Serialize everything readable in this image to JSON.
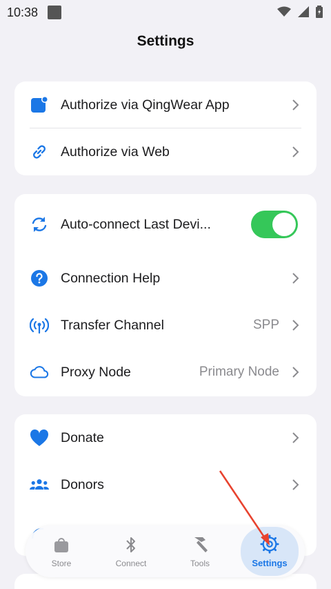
{
  "status": {
    "time": "10:38"
  },
  "header": {
    "title": "Settings"
  },
  "group1": [
    {
      "label": "Authorize via QingWear App",
      "icon": "qingwear-app-icon"
    },
    {
      "label": "Authorize via Web",
      "icon": "link-icon"
    }
  ],
  "group2": [
    {
      "label": "Auto-connect Last Devi...",
      "icon": "sync-icon",
      "toggle": true
    },
    {
      "label": "Connection Help",
      "icon": "help-icon"
    },
    {
      "label": "Transfer Channel",
      "value": "SPP",
      "icon": "antenna-icon"
    },
    {
      "label": "Proxy Node",
      "value": "Primary Node",
      "icon": "cloud-icon"
    }
  ],
  "group3": [
    {
      "label": "Donate",
      "icon": "heart-icon"
    },
    {
      "label": "Donors",
      "icon": "group-icon"
    }
  ],
  "tabs": [
    {
      "label": "Store",
      "icon": "bag-icon"
    },
    {
      "label": "Connect",
      "icon": "bluetooth-icon"
    },
    {
      "label": "Tools",
      "icon": "hammer-icon"
    },
    {
      "label": "Settings",
      "icon": "gear-icon",
      "active": true
    }
  ],
  "colors": {
    "accent": "#1b77e6",
    "toggle_on": "#35c759",
    "background": "#f2f1f6",
    "annotation_arrow": "#e8432f"
  }
}
